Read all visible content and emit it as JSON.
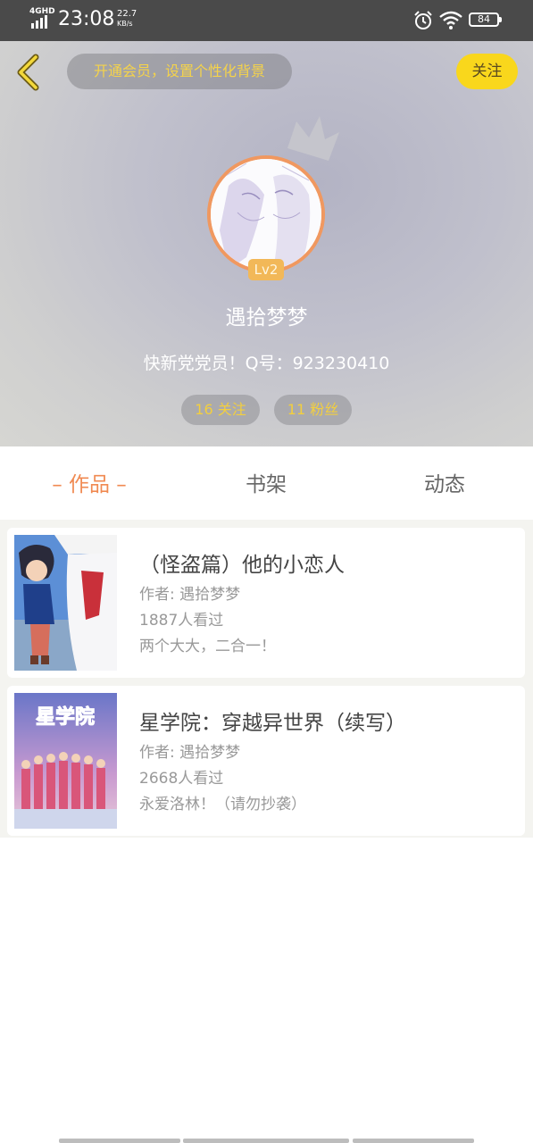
{
  "status_bar": {
    "network": "4GHD",
    "time": "23:08",
    "speed_value": "22.7",
    "speed_unit": "KB/s",
    "battery": "84"
  },
  "header": {
    "vip_prompt": "开通会员，设置个性化背景",
    "follow_label": "关注",
    "level": "Lv2",
    "nickname": "遇拾梦梦",
    "bio": "快新党党员！Q号：923230410",
    "following_label": "16 关注",
    "fans_label": "11 粉丝"
  },
  "tabs": {
    "works": "– 作品 –",
    "shelf": "书架",
    "feed": "动态"
  },
  "books": [
    {
      "title": "（怪盗篇）他的小恋人",
      "author": "作者: 遇拾梦梦",
      "views": "1887人看过",
      "desc": "两个大大，二合一！"
    },
    {
      "title": "星学院：穿越异世界（续写）",
      "author": "作者: 遇拾梦梦",
      "views": "2668人看过",
      "desc": "永爱洛林！（请勿抄袭）",
      "cover_logo": "星学院"
    }
  ],
  "colors": {
    "accent_orange": "#f08a52",
    "follow_yellow": "#f9d71c",
    "vip_text_yellow": "#f5d34a"
  }
}
